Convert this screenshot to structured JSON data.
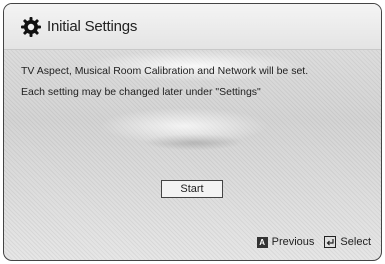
{
  "header": {
    "title": "Initial Settings",
    "icon": "gear-icon"
  },
  "description": {
    "line1": "TV Aspect, Musical Room Calibration and Network will be set.",
    "line2": "Each setting may be changed later under \"Settings\""
  },
  "start_button": {
    "label": "Start"
  },
  "footer": {
    "previous": {
      "key": "A",
      "label": "Previous",
      "icon": "a-button-icon"
    },
    "select": {
      "label": "Select",
      "icon": "enter-icon"
    }
  }
}
